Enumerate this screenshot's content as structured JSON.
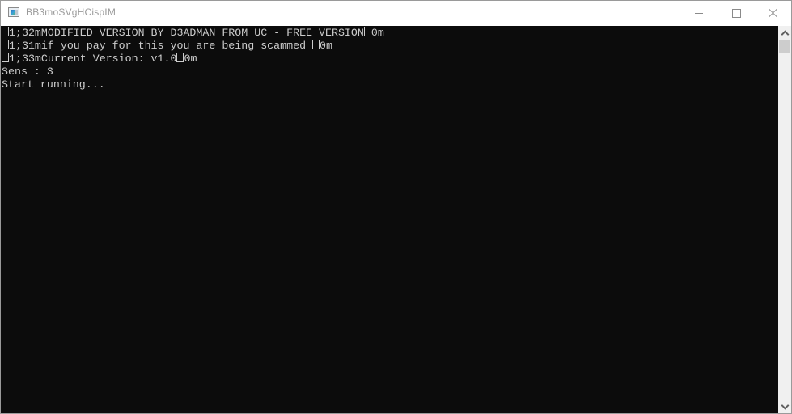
{
  "window": {
    "title": "BB3moSVgHCispIM",
    "app_icon": "console-app-icon",
    "controls": {
      "minimize": "minimize-icon",
      "maximize": "maximize-icon",
      "close": "close-icon"
    }
  },
  "console": {
    "background": "#0c0c0c",
    "foreground": "#cccccc",
    "lines": [
      {
        "prefix_glyph": "escape-char-box",
        "text": "1;32mMODIFIED VERSION BY D3ADMAN FROM UC - FREE VERSION",
        "suffix_glyph": "escape-char-box",
        "suffix": "0m"
      },
      {
        "prefix_glyph": "escape-char-box",
        "text": "1;31mif you pay for this you are being scammed ",
        "suffix_glyph": "escape-char-box",
        "suffix": "0m"
      },
      {
        "prefix_glyph": "escape-char-box",
        "text": "1;33mCurrent Version: v1.0",
        "suffix_glyph": "escape-char-box",
        "suffix": "0m"
      },
      {
        "text": "Sens : 3"
      },
      {
        "text": "Start running..."
      }
    ]
  },
  "scrollbar": {
    "up_arrow": "chevron-up-icon",
    "down_arrow": "chevron-down-icon",
    "scroll_position": 0
  }
}
